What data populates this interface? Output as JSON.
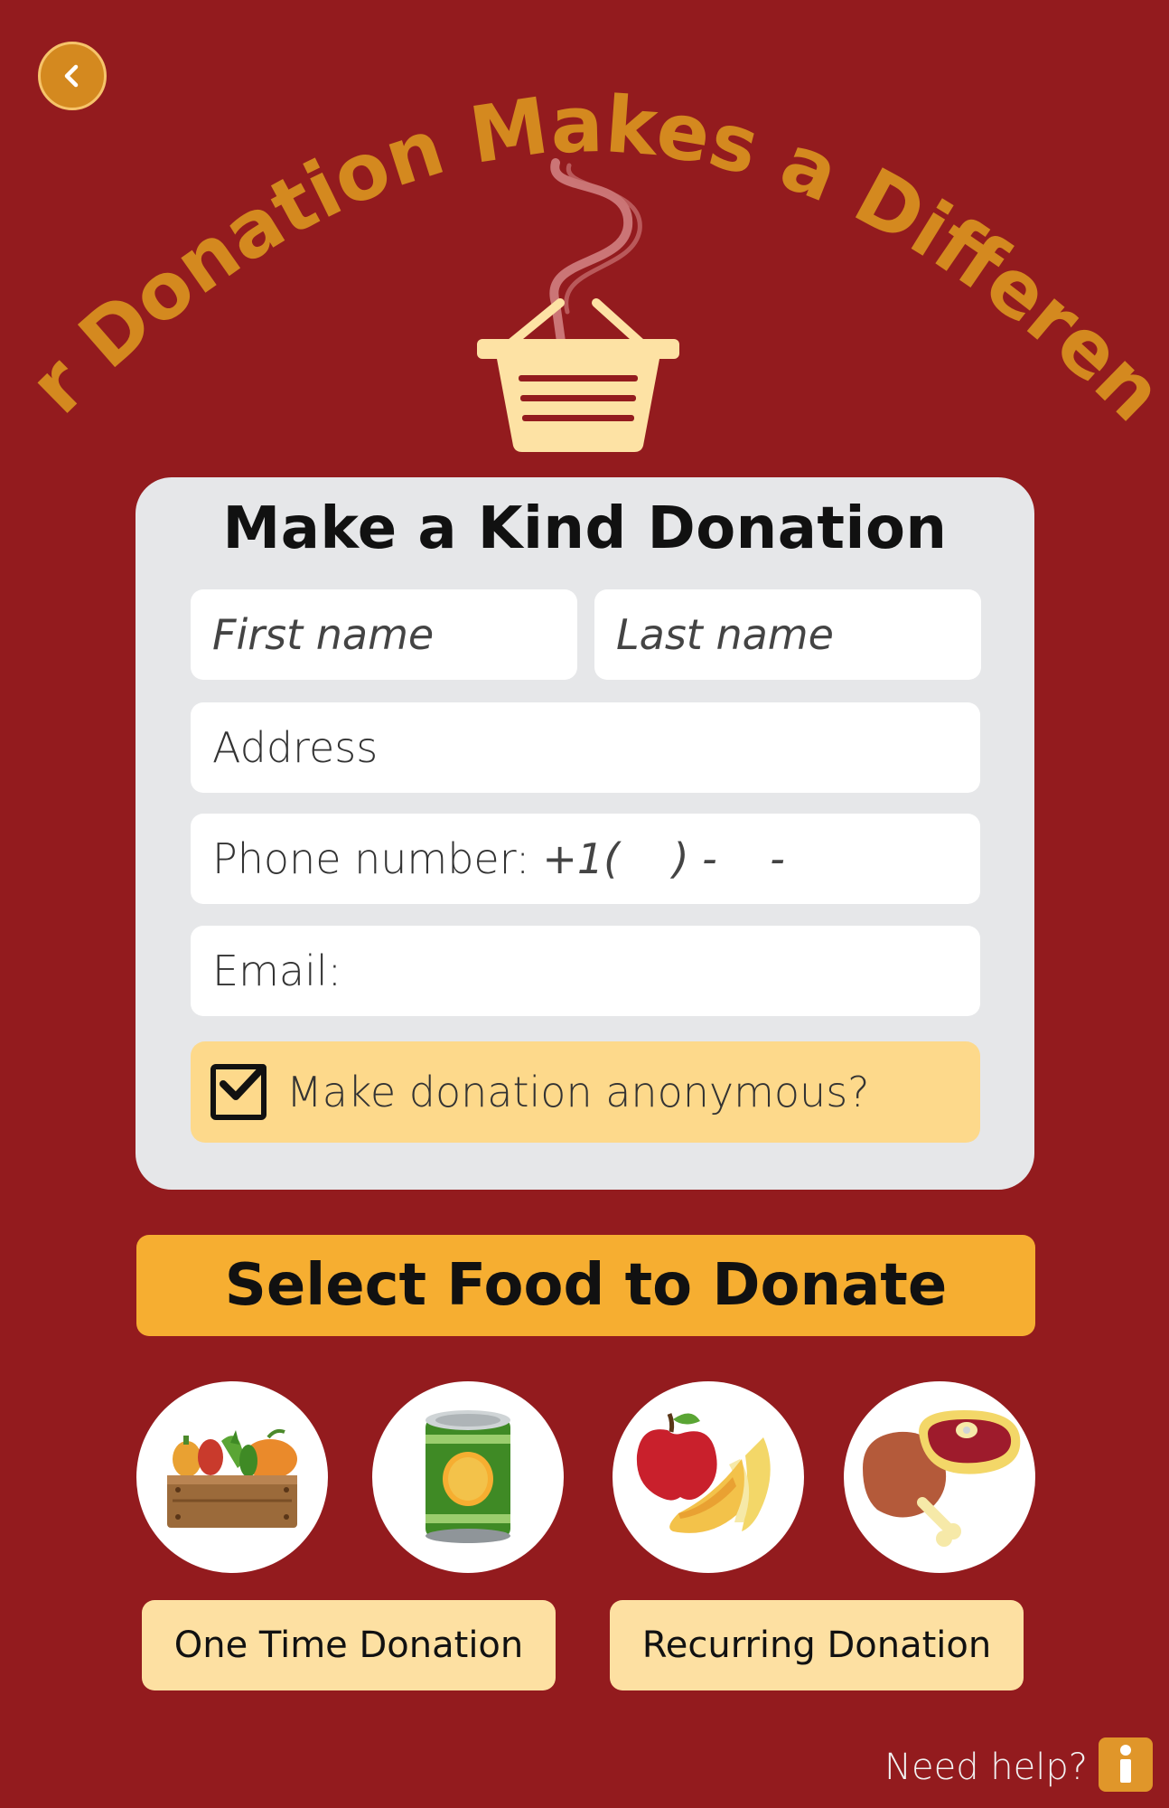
{
  "header": {
    "back_label": "back",
    "headline": "Your Donation Makes a Difference!"
  },
  "form": {
    "title": "Make a Kind Donation",
    "first_name_placeholder": "First name",
    "last_name_placeholder": "Last name",
    "address_placeholder": "Address",
    "phone_label": "Phone number:",
    "phone_mask": "+1(    ) -    -",
    "email_label": "Email:",
    "anonymous_label": "Make donation anonymous?",
    "anonymous_checked": true
  },
  "select_food_label": "Select Food to Donate",
  "food_options": [
    {
      "icon": "produce-crate-icon"
    },
    {
      "icon": "canned-food-icon"
    },
    {
      "icon": "fruit-icon"
    },
    {
      "icon": "meat-icon"
    }
  ],
  "donation_types": {
    "one_time": "One Time Donation",
    "recurring": "Recurring Donation"
  },
  "help": {
    "label": "Need help?"
  },
  "colors": {
    "background": "#931b1e",
    "accent": "#d4891f",
    "button": "#f6ae31",
    "card": "#e6e7e9",
    "soft_yellow": "#fde0a2"
  }
}
